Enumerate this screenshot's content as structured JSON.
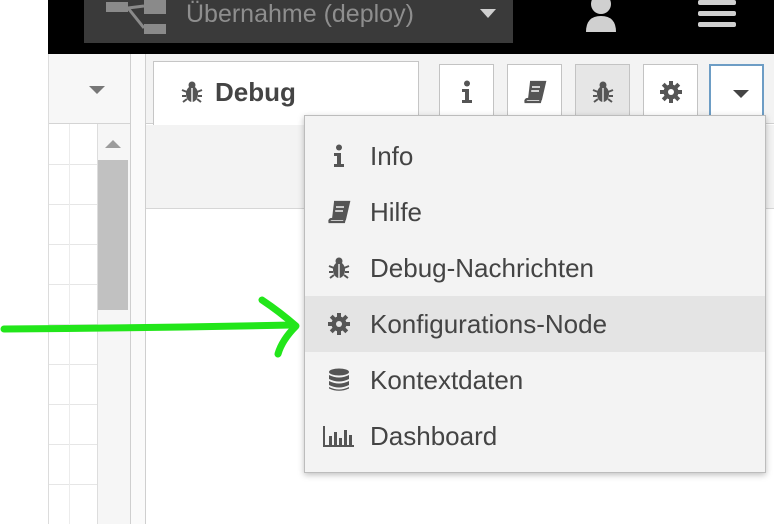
{
  "header": {
    "deploy_label": "Übernahme (deploy)"
  },
  "sidebar": {
    "active_tab_label": "Debug",
    "toolbar_buttons": [
      "info",
      "help",
      "debug",
      "config",
      "more"
    ]
  },
  "menu": {
    "items": [
      {
        "label": "Info",
        "icon": "info-icon"
      },
      {
        "label": "Hilfe",
        "icon": "book-icon"
      },
      {
        "label": "Debug-Nachrichten",
        "icon": "bug-icon"
      },
      {
        "label": "Konfigurations-Node",
        "icon": "gear-icon"
      },
      {
        "label": "Kontextdaten",
        "icon": "database-icon"
      },
      {
        "label": "Dashboard",
        "icon": "bar-chart-icon"
      }
    ],
    "hovered_index": 3
  },
  "colors": {
    "header_bg": "#000000",
    "deploy_bg": "#3a3a3a",
    "arrow": "#22e61a",
    "menu_bg": "#f3f3f3",
    "menu_hover": "#e4e4e4",
    "icon": "#555555"
  }
}
